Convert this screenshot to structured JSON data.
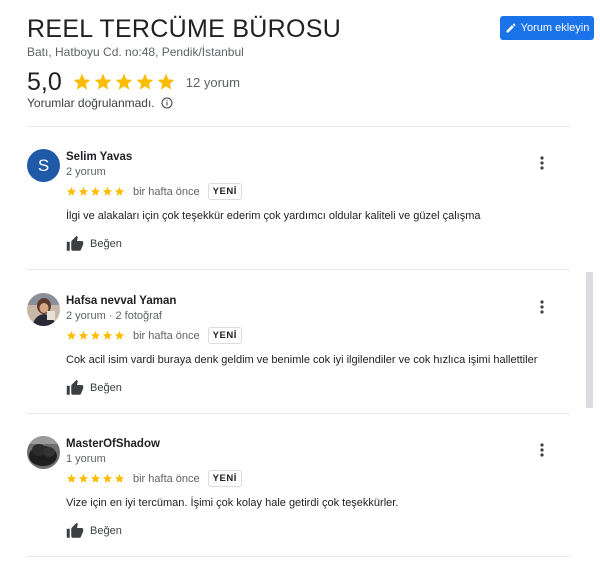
{
  "business": {
    "name": "REEL TERCÜME BÜROSU",
    "address": "Batı, Hatboyu Cd. no:48, Pendik/İstanbul",
    "add_review_label": "Yorum ekleyin",
    "rating": "5,0",
    "review_count": "12 yorum",
    "verify_note": "Yorumlar doğrulanmadı.",
    "accent_color": "#1a73e8",
    "star_color": "#fbbc04"
  },
  "reviews": [
    {
      "name": "Selim Yavas",
      "avatar_letter": "S",
      "meta": "2 yorum",
      "stars": 5,
      "time": "bir hafta önce",
      "badge": "YENİ",
      "text": "İlgi ve alakaları için çok teşekkür ederim çok yardımcı oldular kaliteli ve güzel çalışma",
      "like_label": "Beğen"
    },
    {
      "name": "Hafsa nevval Yaman",
      "avatar_letter": "",
      "meta": "2 yorum · 2 fotoğraf",
      "stars": 5,
      "time": "bir hafta önce",
      "badge": "YENİ",
      "text": "Cok acil isim vardi buraya denk geldim ve benimle cok iyi ilgilendiler ve cok hızlıca işimi hallettiler",
      "like_label": "Beğen"
    },
    {
      "name": "MasterOfShadow",
      "avatar_letter": "",
      "meta": "1 yorum",
      "stars": 5,
      "time": "bir hafta önce",
      "badge": "YENİ",
      "text": "Vize için en iyi tercüman. İşimi çok kolay hale getirdi çok teşekkürler.",
      "like_label": "Beğen"
    }
  ]
}
